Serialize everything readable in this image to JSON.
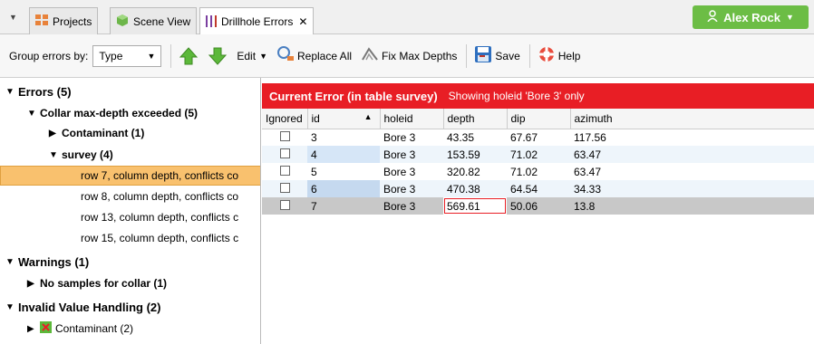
{
  "tabs": {
    "projects": "Projects",
    "scene_view": "Scene View",
    "drillhole_errors": "Drillhole Errors",
    "close": "✕"
  },
  "user": {
    "name": "Alex Rock"
  },
  "toolbar": {
    "group_label": "Group errors by:",
    "group_value": "Type",
    "edit": "Edit",
    "replace_all": "Replace All",
    "fix_max_depths": "Fix Max Depths",
    "save": "Save",
    "help": "Help"
  },
  "tree": {
    "errors": "Errors (5)",
    "collar": "Collar max-depth exceeded (5)",
    "contaminant": "Contaminant (1)",
    "survey": "survey (4)",
    "rows": [
      "row 7, column depth, conflicts co",
      "row 8, column depth, conflicts co",
      "row 13, column depth, conflicts c",
      "row 15, column depth, conflicts c"
    ],
    "warnings": "Warnings (1)",
    "no_samples": "No samples for collar (1)",
    "invalid": "Invalid Value Handling (2)",
    "contaminant2": "Contaminant (2)"
  },
  "current_error": {
    "title": "Current Error (in table survey)",
    "subtitle": "Showing holeid 'Bore 3' only"
  },
  "table": {
    "headers": [
      "Ignored",
      "id",
      "holeid",
      "depth",
      "dip",
      "azimuth"
    ],
    "rows": [
      [
        "3",
        "Bore 3",
        "43.35",
        "67.67",
        "117.56"
      ],
      [
        "4",
        "Bore 3",
        "153.59",
        "71.02",
        "63.47"
      ],
      [
        "5",
        "Bore 3",
        "320.82",
        "71.02",
        "63.47"
      ],
      [
        "6",
        "Bore 3",
        "470.38",
        "64.54",
        "34.33"
      ],
      [
        "7",
        "Bore 3",
        "569.61",
        "50.06",
        "13.8"
      ]
    ]
  },
  "colors": {
    "accent_green": "#6cbd45",
    "error_red": "#e81e25",
    "selection": "#f9c16e"
  }
}
